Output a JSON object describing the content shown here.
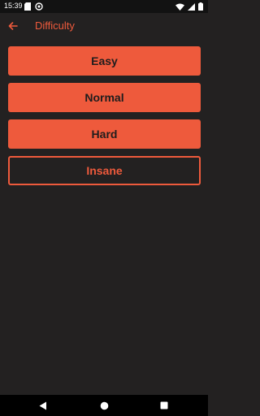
{
  "status_bar": {
    "time": "15:39",
    "left_icons": [
      "sd-card-icon",
      "sync-icon"
    ],
    "right_icons": [
      "wifi-icon",
      "signal-icon",
      "battery-icon"
    ]
  },
  "app_bar": {
    "title": "Difficulty",
    "back_icon": "arrow-left-icon"
  },
  "difficulty": {
    "options": [
      {
        "label": "Easy",
        "style": "filled"
      },
      {
        "label": "Normal",
        "style": "filled"
      },
      {
        "label": "Hard",
        "style": "filled"
      },
      {
        "label": "Insane",
        "style": "outlined"
      }
    ],
    "selected": "Insane"
  },
  "nav_bar": {
    "buttons": [
      "back-triangle-icon",
      "home-circle-icon",
      "recents-square-icon"
    ]
  },
  "colors": {
    "accent": "#ee5a3c",
    "background": "#232121",
    "status_bar": "#121212",
    "nav_bar": "#000000"
  }
}
